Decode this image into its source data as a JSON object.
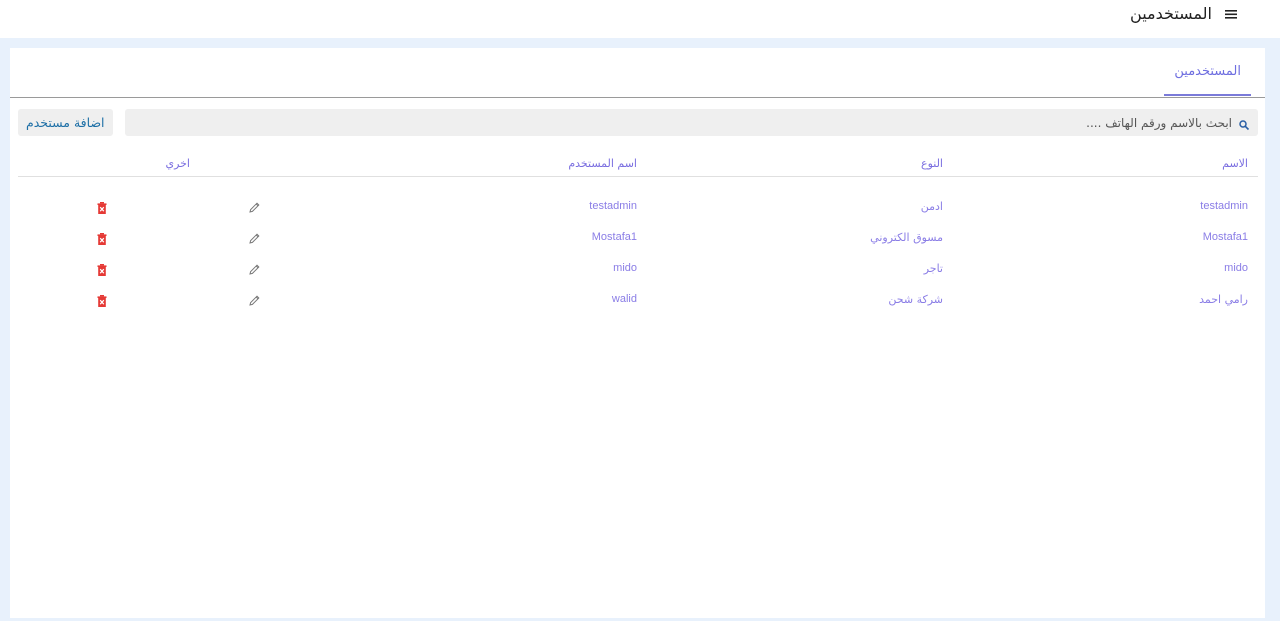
{
  "header": {
    "title": "المستخدمين",
    "menu_icon": "hamburger-menu-icon"
  },
  "tabs": [
    {
      "label": "المستخدمين",
      "active": true
    }
  ],
  "search": {
    "placeholder": "ابحث بالاسم ورقم الهاتف ....",
    "value": "",
    "icon": "search-icon"
  },
  "toolbar": {
    "add_label": "اضافة مستخدم"
  },
  "table": {
    "columns": {
      "name": "الاسم",
      "type": "النوع",
      "username": "اسم المستخدم",
      "other": "اخري"
    },
    "rows": [
      {
        "name": "testadmin",
        "type": "ادمن",
        "username": "testadmin"
      },
      {
        "name": "Mostafa1",
        "type": "مسوق الكتروني",
        "username": "Mostafa1"
      },
      {
        "name": "mido",
        "type": "تاجر",
        "username": "mido"
      },
      {
        "name": "رامي احمد",
        "type": "شركة شحن",
        "username": "walid"
      }
    ],
    "row_actions": [
      "edit-pencil-icon",
      "delete-trash-icon"
    ]
  },
  "colors": {
    "accent": "#7b7bd9",
    "link": "#1d6fa6",
    "danger": "#e53935",
    "background": "#e8f1fc"
  }
}
